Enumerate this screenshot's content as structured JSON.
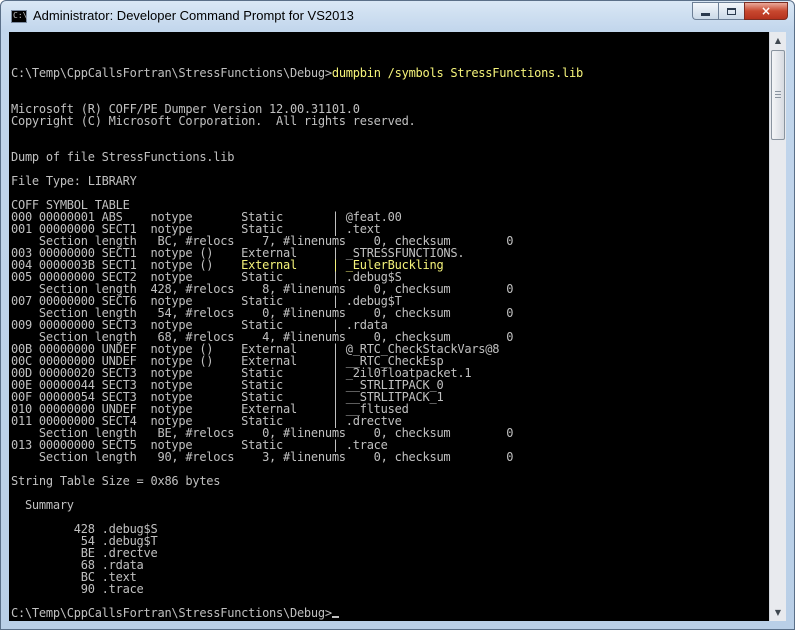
{
  "window": {
    "title": "Administrator: Developer Command Prompt for VS2013",
    "icon": "console-icon",
    "icon_text": "C:\\",
    "controls": {
      "minimize": "minimize-icon",
      "maximize": "maximize-icon",
      "close": "×"
    }
  },
  "console": {
    "prompt_path": "C:\\Temp\\CppCallsFortran\\StressFunctions\\Debug>",
    "command": "dumpbin /symbols StressFunctions.lib",
    "lines": [
      "Microsoft (R) COFF/PE Dumper Version 12.00.31101.0",
      "Copyright (C) Microsoft Corporation.  All rights reserved.",
      "",
      "",
      "Dump of file StressFunctions.lib",
      "",
      "File Type: LIBRARY",
      "",
      "COFF SYMBOL TABLE",
      "000 00000001 ABS    notype       Static       | @feat.00",
      "001 00000000 SECT1  notype       Static       | .text",
      "    Section length   BC, #relocs    7, #linenums    0, checksum        0",
      "003 00000000 SECT1  notype ()    External     | _STRESSFUNCTIONS.",
      "004 0000003B SECT1  notype ()    ",
      "005 00000000 SECT2  notype       Static       | .debug$S",
      "    Section length  428, #relocs    8, #linenums    0, checksum        0",
      "007 00000000 SECT6  notype       Static       | .debug$T",
      "    Section length   54, #relocs    0, #linenums    0, checksum        0",
      "009 00000000 SECT3  notype       Static       | .rdata",
      "    Section length   68, #relocs    4, #linenums    0, checksum        0",
      "00B 00000000 UNDEF  notype ()    External     | @_RTC_CheckStackVars@8",
      "00C 00000000 UNDEF  notype ()    External     | __RTC_CheckEsp",
      "00D 00000020 SECT3  notype       Static       | _2il0floatpacket.1",
      "00E 00000044 SECT3  notype       Static       | __STRLITPACK_0",
      "00F 00000054 SECT3  notype       Static       | __STRLITPACK_1",
      "010 00000000 UNDEF  notype       External     | __fltused",
      "011 00000000 SECT4  notype       Static       | .drectve",
      "    Section length   BE, #relocs    0, #linenums    0, checksum        0",
      "013 00000000 SECT5  notype       Static       | .trace",
      "    Section length   90, #relocs    3, #linenums    0, checksum        0",
      "",
      "String Table Size = 0x86 bytes",
      "",
      "  Summary",
      "",
      "         428 .debug$S",
      "          54 .debug$T",
      "          BE .drectve",
      "          68 .rdata",
      "          BC .text",
      "          90 .trace",
      "",
      "C:\\Temp\\CppCallsFortran\\StressFunctions\\Debug>"
    ],
    "highlighted": "External     | _EulerBuckling",
    "highlight_line_index": 13,
    "colors": {
      "background": "#000000",
      "text": "#c0c0c0",
      "highlight": "#f5f37a"
    }
  },
  "scrollbar": {
    "up_arrow": "▲",
    "down_arrow": "▼"
  }
}
